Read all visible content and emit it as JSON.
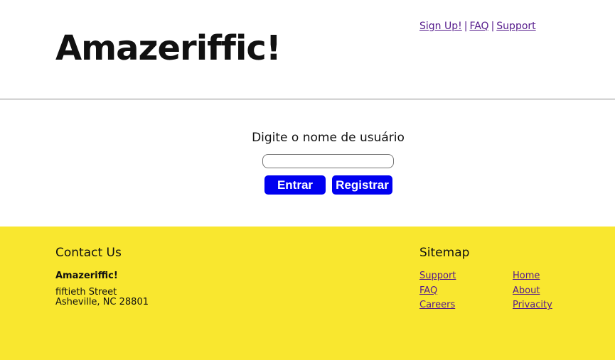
{
  "header": {
    "logo": "Amazeriffic!",
    "links": [
      "Sign Up!",
      "FAQ",
      "Support"
    ],
    "separator": "|"
  },
  "main": {
    "prompt": "Digite o nome de usuário",
    "username_value": "",
    "enter_label": "Entrar",
    "register_label": "Registrar"
  },
  "footer": {
    "contact_title": "Contact Us",
    "company": "Amazeriffic!",
    "street": "fiftieth Street",
    "city": "Asheville, NC 28801",
    "sitemap_title": "Sitemap",
    "sitemap_col1": [
      "Support",
      "FAQ",
      "Careers"
    ],
    "sitemap_col2": [
      "Home",
      "About",
      "Privacity"
    ]
  },
  "colors": {
    "button": "#0000f0",
    "footer": "#f9e72f",
    "link": "#551a8b"
  }
}
